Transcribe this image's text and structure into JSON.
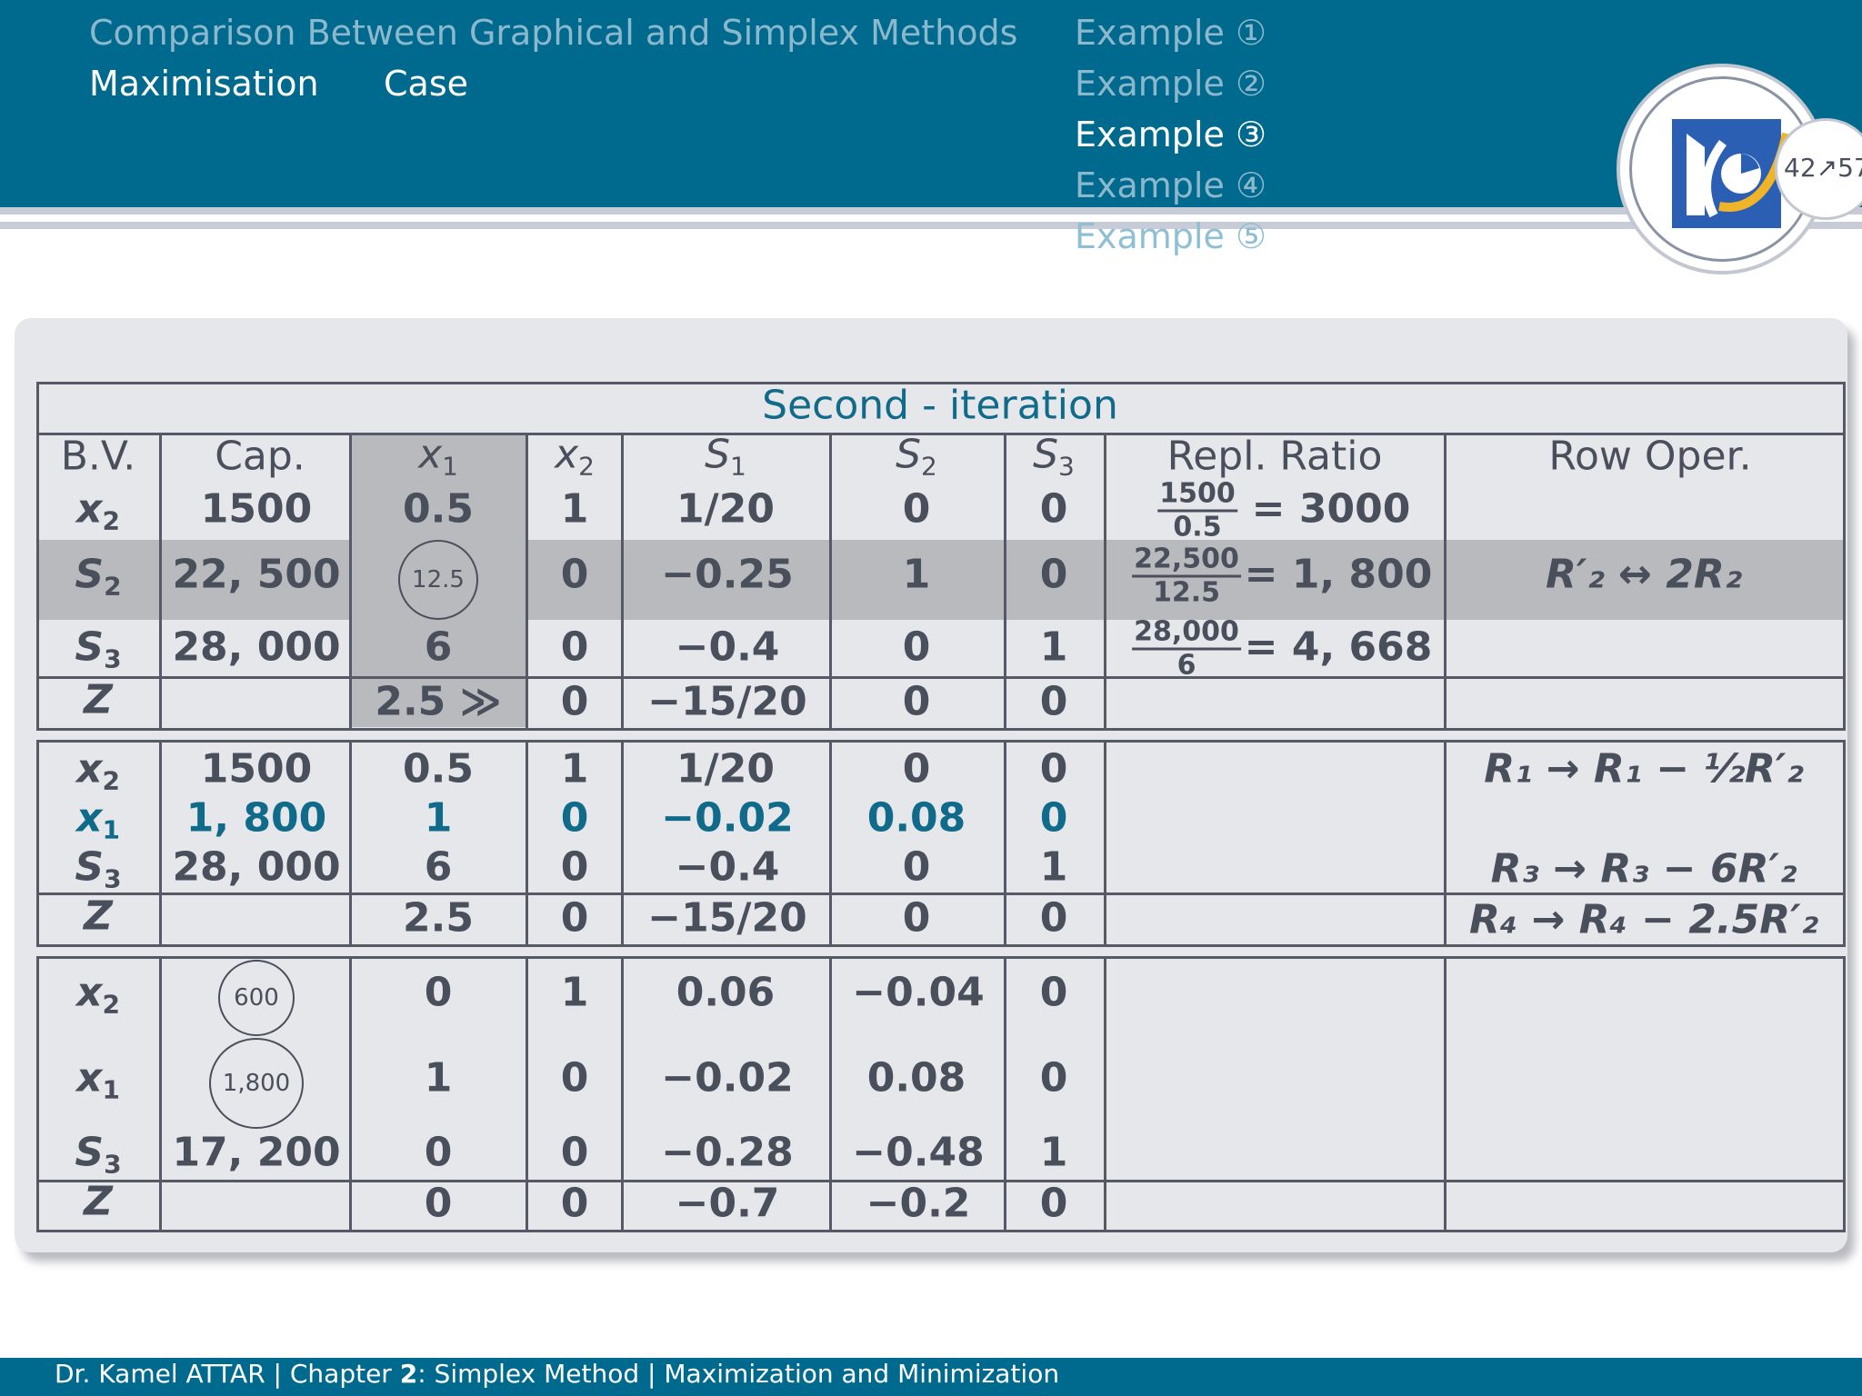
{
  "header": {
    "title": "Comparison Between Graphical and Simplex Methods",
    "subtitle_1": "Maximisation",
    "subtitle_2": "Case",
    "examples": [
      "Example ①",
      "Example ②",
      "Example ③",
      "Example ④",
      "Example ⑤"
    ],
    "current_example": 3,
    "page_indicator": "42↗57"
  },
  "table": {
    "title": "Second - iteration",
    "headers": {
      "bv": "B.V.",
      "cap": "Cap.",
      "x1": "x",
      "x1_sub": "1",
      "x2": "x",
      "x2_sub": "2",
      "s1": "S",
      "s1_sub": "1",
      "s2": "S",
      "s2_sub": "2",
      "s3": "S",
      "s3_sub": "3",
      "ratio": "Repl. Ratio",
      "rowop": "Row Oper."
    },
    "block1": {
      "rows": [
        {
          "bv": "x",
          "bv_sub": "2",
          "cap": "1500",
          "x1": "0.5",
          "x2": "1",
          "s1": "1/20",
          "s2": "0",
          "s3": "0",
          "ratio_num": "1500",
          "ratio_den": "0.5",
          "ratio_val": "= 3000"
        },
        {
          "bv": "S",
          "bv_sub": "2",
          "cap": "22, 500",
          "x1": "12.5",
          "x2": "0",
          "s1": "−0.25",
          "s2": "1",
          "s3": "0",
          "ratio_num": "22,500",
          "ratio_den": "12.5",
          "ratio_val": "= 1, 800",
          "rowop": "R′₂ ↔ 2R₂"
        },
        {
          "bv": "S",
          "bv_sub": "3",
          "cap": "28, 000",
          "x1": "6",
          "x2": "0",
          "s1": "−0.4",
          "s2": "0",
          "s3": "1",
          "ratio_num": "28,000",
          "ratio_den": "6",
          "ratio_val": "= 4, 668"
        }
      ],
      "z": {
        "bv": "Z",
        "x1": "2.5 ≫",
        "x2": "0",
        "s1": "−15/20",
        "s2": "0",
        "s3": "0"
      }
    },
    "block2": {
      "rows": [
        {
          "bv": "x",
          "bv_sub": "2",
          "cap": "1500",
          "x1": "0.5",
          "x2": "1",
          "s1": "1/20",
          "s2": "0",
          "s3": "0",
          "rowop": "R₁ → R₁ − ½R′₂"
        },
        {
          "bv": "x",
          "bv_sub": "1",
          "cap": "1, 800",
          "x1": "1",
          "x2": "0",
          "s1": "−0.02",
          "s2": "0.08",
          "s3": "0"
        },
        {
          "bv": "S",
          "bv_sub": "3",
          "cap": "28, 000",
          "x1": "6",
          "x2": "0",
          "s1": "−0.4",
          "s2": "0",
          "s3": "1",
          "rowop": "R₃ → R₃ − 6R′₂"
        }
      ],
      "z": {
        "bv": "Z",
        "x1": "2.5",
        "x2": "0",
        "s1": "−15/20",
        "s2": "0",
        "s3": "0",
        "rowop": "R₄ → R₄ − 2.5R′₂"
      }
    },
    "block3": {
      "rows": [
        {
          "bv": "x",
          "bv_sub": "2",
          "cap": "600",
          "x1": "0",
          "x2": "1",
          "s1": "0.06",
          "s2": "−0.04",
          "s3": "0"
        },
        {
          "bv": "x",
          "bv_sub": "1",
          "cap": "1,800",
          "x1": "1",
          "x2": "0",
          "s1": "−0.02",
          "s2": "0.08",
          "s3": "0"
        },
        {
          "bv": "S",
          "bv_sub": "3",
          "cap": "17, 200",
          "x1": "0",
          "x2": "0",
          "s1": "−0.28",
          "s2": "−0.48",
          "s3": "1"
        }
      ],
      "z": {
        "bv": "Z",
        "x1": "0",
        "x2": "0",
        "s1": "−0.7",
        "s2": "−0.2",
        "s3": "0"
      }
    }
  },
  "footer": {
    "author": "Dr. Kamel ATTAR | Chapter ",
    "chapter": "2",
    "rest": ": Simplex Method | Maximization and Minimization"
  },
  "colors": {
    "header_bg": "#006a8e",
    "accent": "#106a8a",
    "shade": "#b9babd",
    "panel": "#e6e7ea"
  }
}
